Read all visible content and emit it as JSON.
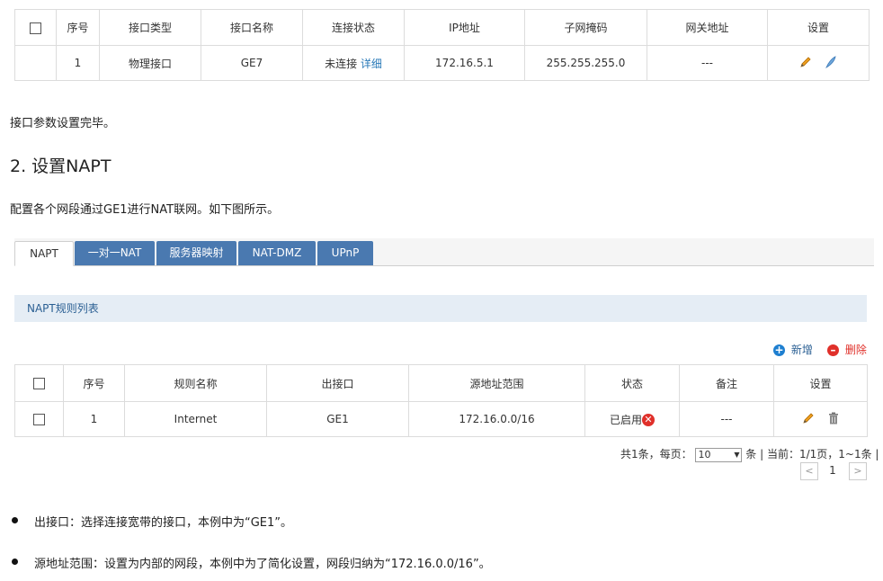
{
  "interface_table": {
    "headers": [
      "序号",
      "接口类型",
      "接口名称",
      "连接状态",
      "IP地址",
      "子网掩码",
      "网关地址",
      "设置"
    ],
    "row": {
      "index": "1",
      "type": "物理接口",
      "name": "GE7",
      "status": "未连接",
      "status_link": "详细",
      "ip": "172.16.5.1",
      "mask": "255.255.255.0",
      "gateway": "---"
    }
  },
  "text": {
    "done": "接口参数设置完毕。",
    "heading": "2. 设置NAPT",
    "intro": "配置各个网段通过GE1进行NAT联网。如下图所示。"
  },
  "tabs": [
    "NAPT",
    "一对一NAT",
    "服务器映射",
    "NAT-DMZ",
    "UPnP"
  ],
  "panel_title": "NAPT规则列表",
  "actions": {
    "add": "新增",
    "delete": "删除"
  },
  "napt_table": {
    "headers": [
      "序号",
      "规则名称",
      "出接口",
      "源地址范围",
      "状态",
      "备注",
      "设置"
    ],
    "row": {
      "index": "1",
      "name": "Internet",
      "out_if": "GE1",
      "src_range": "172.16.0.0/16",
      "status": "已启用",
      "note": "---"
    }
  },
  "pager": {
    "summary_prefix": "共1条，每页：",
    "per_page": "10",
    "summary_suffix": "条 | 当前：1/1页，1~1条 |",
    "page": "1",
    "prev": "<",
    "next": ">"
  },
  "bullets": [
    "出接口：选择连接宽带的接口，本例中为“GE1”。",
    "源地址范围：设置为内部的网段，本例中为了简化设置，网段归纳为“172.16.0.0/16”。"
  ],
  "colors": {
    "tab_blue": "#4a79b0",
    "panel_bg": "#e5edf5",
    "add_blue": "#1e7fd0",
    "delete_red": "#e0302a",
    "disabled_red": "#e0302a"
  }
}
